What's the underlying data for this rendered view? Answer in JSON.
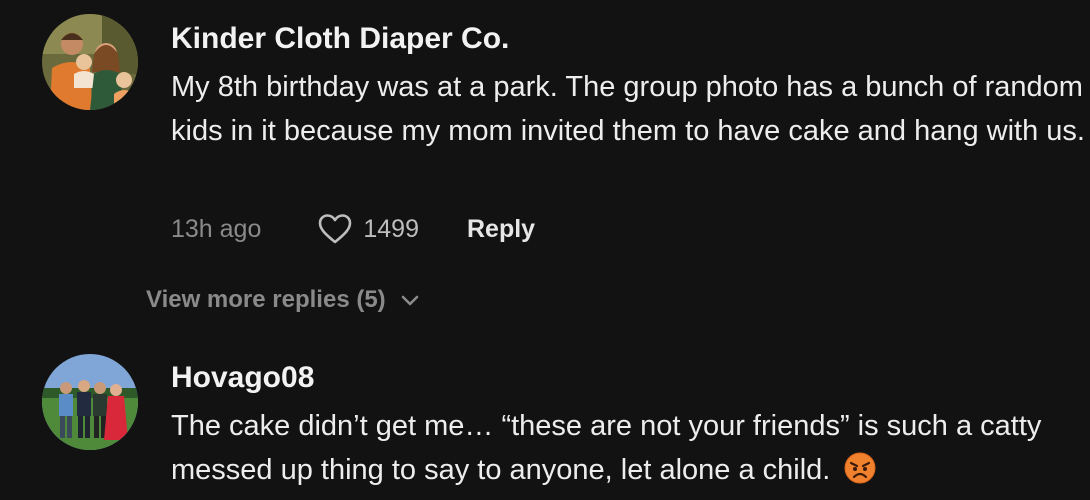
{
  "comments": [
    {
      "username": "Kinder Cloth Diaper Co.",
      "text": "My 8th birthday was at a park. The group photo has a bunch of random kids in it because my mom invited them to have cake and hang with us.",
      "timestamp": "13h ago",
      "likes": "1499",
      "reply_label": "Reply",
      "avatar_icon": "family-photo-avatar"
    },
    {
      "username": "Hovago08",
      "text": "The cake didn’t get me… “these are not your friends” is such a catty messed up thing to say to anyone, let alone a child.",
      "emoji": "angry-face-emoji",
      "avatar_icon": "group-photo-avatar"
    }
  ],
  "replies_toggle": {
    "label": "View more replies (5)",
    "icon": "chevron-down-icon"
  },
  "colors": {
    "background": "#121212",
    "text_primary": "#ededed",
    "text_secondary": "#8a8a8a"
  }
}
